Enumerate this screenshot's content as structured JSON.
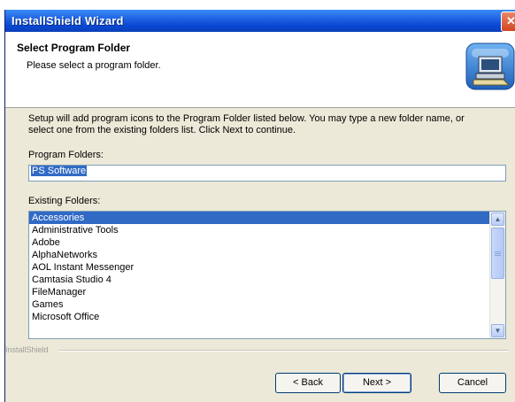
{
  "window": {
    "title": "InstallShield Wizard",
    "close_glyph": "✕"
  },
  "header": {
    "title": "Select Program Folder",
    "subtitle": "Please select a program folder.",
    "icon": "computer-folder-icon"
  },
  "instructions": "Setup will add program icons to the Program Folder listed below.  You may type a new folder name, or select one from the existing folders list.  Click Next to continue.",
  "program_folder": {
    "label": "Program Folders:",
    "value": "PS Software"
  },
  "existing_folders": {
    "label": "Existing Folders:",
    "items": [
      "Accessories",
      "Administrative Tools",
      "Adobe",
      "AlphaNetworks",
      "AOL Instant Messenger",
      "Camtasia Studio 4",
      "FileManager",
      "Games",
      "Microsoft Office"
    ],
    "selected_index": 0
  },
  "brand": "InstallShield",
  "buttons": {
    "back": "< Back",
    "next": "Next >",
    "cancel": "Cancel"
  },
  "colors": {
    "titlebar": "#0a49d6",
    "selection": "#316ac5",
    "dialog_bg": "#ece9d8"
  }
}
